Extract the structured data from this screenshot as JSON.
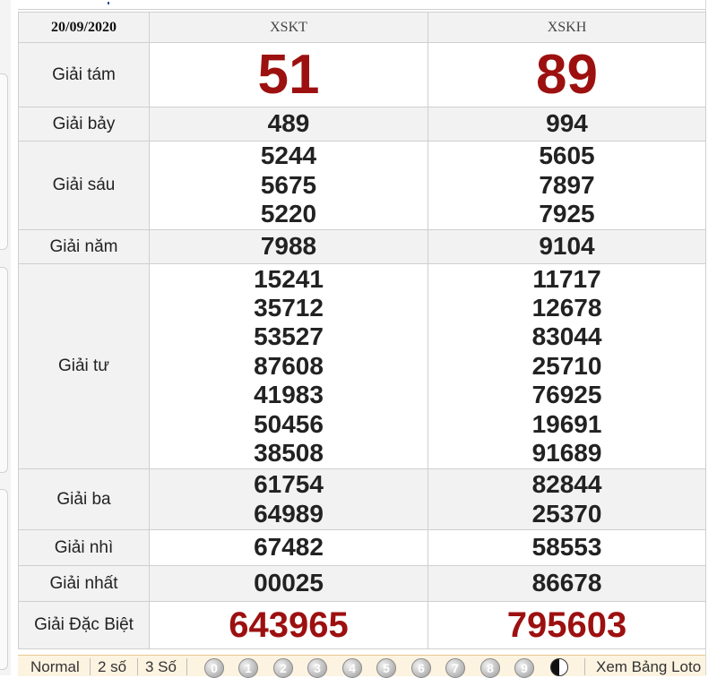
{
  "date": "20/09/2020",
  "provinces": [
    "XSKT",
    "XSKH"
  ],
  "prizes": [
    {
      "label": "Giải tám",
      "kt": [
        "51"
      ],
      "kh": [
        "89"
      ]
    },
    {
      "label": "Giải bảy",
      "kt": [
        "489"
      ],
      "kh": [
        "994"
      ]
    },
    {
      "label": "Giải sáu",
      "kt": [
        "5244",
        "5675",
        "5220"
      ],
      "kh": [
        "5605",
        "7897",
        "7925"
      ]
    },
    {
      "label": "Giải năm",
      "kt": [
        "7988"
      ],
      "kh": [
        "9104"
      ]
    },
    {
      "label": "Giải tư",
      "kt": [
        "15241",
        "35712",
        "53527",
        "87608",
        "41983",
        "50456",
        "38508"
      ],
      "kh": [
        "11717",
        "12678",
        "83044",
        "25710",
        "76925",
        "19691",
        "91689"
      ]
    },
    {
      "label": "Giải ba",
      "kt": [
        "61754",
        "64989"
      ],
      "kh": [
        "82844",
        "25370"
      ]
    },
    {
      "label": "Giải nhì",
      "kt": [
        "67482"
      ],
      "kh": [
        "58553"
      ]
    },
    {
      "label": "Giải nhất",
      "kt": [
        "00025"
      ],
      "kh": [
        "86678"
      ]
    },
    {
      "label": "Giải Đặc Biệt",
      "kt": [
        "643965"
      ],
      "kh": [
        "795603"
      ]
    }
  ],
  "bottombar": {
    "normal": "Normal",
    "two_digits": "2 số",
    "three_digits": "3 Số",
    "digits": [
      "0",
      "1",
      "2",
      "3",
      "4",
      "5",
      "6",
      "7",
      "8",
      "9"
    ],
    "view_loto": "Xem Bảng Loto"
  },
  "colors": {
    "special": "#9d1010",
    "number": "#222222",
    "row_grey": "#f2f2f2",
    "bar_bg": "#fdf3e1"
  }
}
